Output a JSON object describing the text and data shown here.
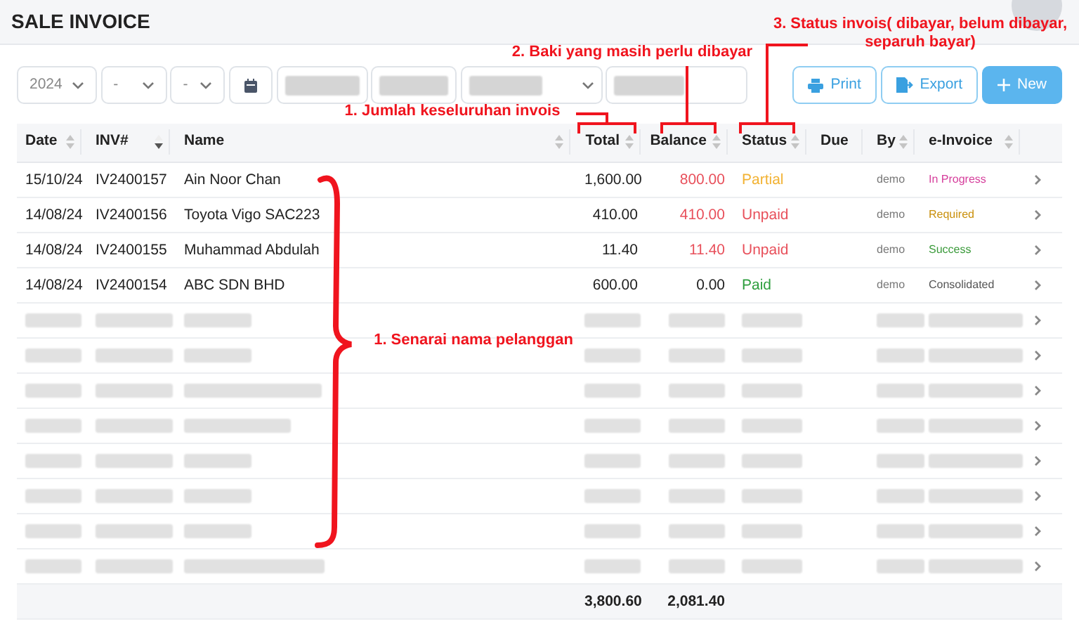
{
  "page_title": "SALE INVOICE",
  "filters": {
    "year": "2024",
    "month": "-",
    "day": "-"
  },
  "buttons": [
    {
      "kind": "print",
      "label": "Print"
    },
    {
      "kind": "export",
      "label": "Export"
    },
    {
      "kind": "new",
      "label": "New"
    }
  ],
  "table": {
    "columns": [
      {
        "label": "Date",
        "sortable": true,
        "sorted": false
      },
      {
        "label": "INV#",
        "sortable": true,
        "sorted": true
      },
      {
        "label": "Name",
        "sortable": true,
        "sorted": false
      },
      {
        "label": "Total",
        "sortable": true,
        "sorted": false
      },
      {
        "label": "Balance",
        "sortable": true,
        "sorted": false
      },
      {
        "label": "Status",
        "sortable": true,
        "sorted": false
      },
      {
        "label": "Due",
        "sortable": false,
        "sorted": false
      },
      {
        "label": "By",
        "sortable": true,
        "sorted": false
      },
      {
        "label": "e-Invoice",
        "sortable": true,
        "sorted": false
      }
    ],
    "rows": [
      {
        "kind": "invoice",
        "date": "15/10/24",
        "inv": "IV2400157",
        "name": "Ain Noor Chan",
        "total": "1,600.00",
        "balance": {
          "text": "800.00",
          "color": "#e8505b"
        },
        "status": {
          "text": "Partial",
          "color": "#f2b233"
        },
        "by": "demo",
        "e_invoice": {
          "text": "In Progress",
          "color": "#d63f9c"
        }
      },
      {
        "kind": "invoice",
        "date": "14/08/24",
        "inv": "IV2400156",
        "name": "Toyota Vigo SAC223",
        "total": "410.00",
        "balance": {
          "text": "410.00",
          "color": "#e8505b"
        },
        "status": {
          "text": "Unpaid",
          "color": "#e8505b"
        },
        "by": "demo",
        "e_invoice": {
          "text": "Required",
          "color": "#c98f0a"
        }
      },
      {
        "kind": "invoice",
        "date": "14/08/24",
        "inv": "IV2400155",
        "name": "Muhammad Abdulah",
        "total": "11.40",
        "balance": {
          "text": "11.40",
          "color": "#e8505b"
        },
        "status": {
          "text": "Unpaid",
          "color": "#e8505b"
        },
        "by": "demo",
        "e_invoice": {
          "text": "Success",
          "color": "#3a9a3a"
        }
      },
      {
        "kind": "invoice",
        "date": "14/08/24",
        "inv": "IV2400154",
        "name": "ABC SDN BHD",
        "total": "600.00",
        "balance": {
          "text": "0.00",
          "color": "#222222"
        },
        "status": {
          "text": "Paid",
          "color": "#2e9e3e"
        },
        "by": "demo",
        "e_invoice": {
          "text": "Consolidated",
          "color": "#555555"
        }
      },
      {
        "kind": "redacted"
      },
      {
        "kind": "redacted"
      },
      {
        "kind": "redacted"
      },
      {
        "kind": "redacted"
      },
      {
        "kind": "redacted"
      },
      {
        "kind": "redacted"
      },
      {
        "kind": "redacted"
      },
      {
        "kind": "redacted"
      }
    ],
    "footer": {
      "total": "3,800.60",
      "balance": "2,081.40"
    }
  },
  "annotations": [
    {
      "kind": "total",
      "text": "1. Jumlah keseluruhan invois"
    },
    {
      "kind": "balance",
      "text": "2. Baki yang masih perlu dibayar"
    },
    {
      "kind": "status",
      "text": "3. Status invois( dibayar, belum dibayar,\nseparuh bayar)"
    },
    {
      "kind": "names",
      "text": "1. Senarai nama pelanggan"
    }
  ]
}
